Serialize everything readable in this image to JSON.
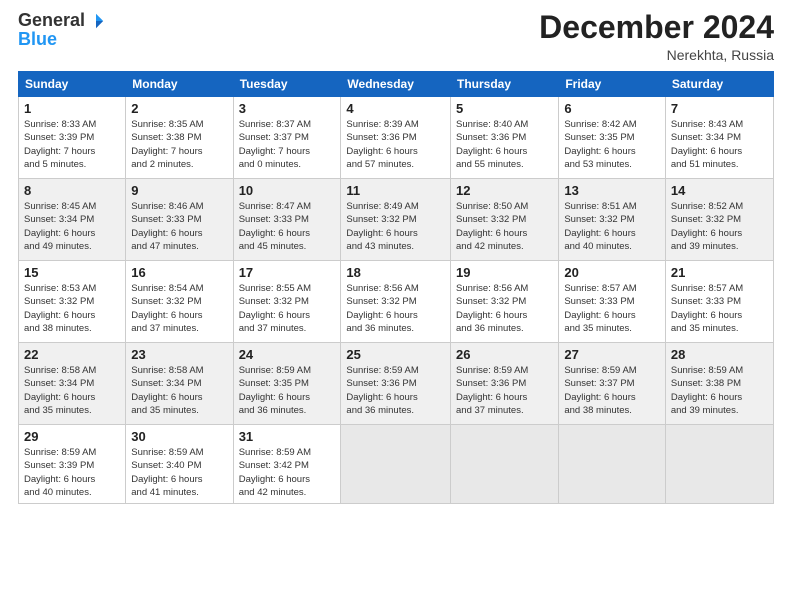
{
  "logo": {
    "general": "General",
    "blue": "Blue"
  },
  "title": "December 2024",
  "location": "Nerekhta, Russia",
  "weekdays": [
    "Sunday",
    "Monday",
    "Tuesday",
    "Wednesday",
    "Thursday",
    "Friday",
    "Saturday"
  ],
  "weeks": [
    [
      {
        "day": "1",
        "sunrise": "8:33 AM",
        "sunset": "3:39 PM",
        "daylight": "7 hours and 5 minutes."
      },
      {
        "day": "2",
        "sunrise": "8:35 AM",
        "sunset": "3:38 PM",
        "daylight": "7 hours and 2 minutes."
      },
      {
        "day": "3",
        "sunrise": "8:37 AM",
        "sunset": "3:37 PM",
        "daylight": "7 hours and 0 minutes."
      },
      {
        "day": "4",
        "sunrise": "8:39 AM",
        "sunset": "3:36 PM",
        "daylight": "6 hours and 57 minutes."
      },
      {
        "day": "5",
        "sunrise": "8:40 AM",
        "sunset": "3:36 PM",
        "daylight": "6 hours and 55 minutes."
      },
      {
        "day": "6",
        "sunrise": "8:42 AM",
        "sunset": "3:35 PM",
        "daylight": "6 hours and 53 minutes."
      },
      {
        "day": "7",
        "sunrise": "8:43 AM",
        "sunset": "3:34 PM",
        "daylight": "6 hours and 51 minutes."
      }
    ],
    [
      {
        "day": "8",
        "sunrise": "8:45 AM",
        "sunset": "3:34 PM",
        "daylight": "6 hours and 49 minutes."
      },
      {
        "day": "9",
        "sunrise": "8:46 AM",
        "sunset": "3:33 PM",
        "daylight": "6 hours and 47 minutes."
      },
      {
        "day": "10",
        "sunrise": "8:47 AM",
        "sunset": "3:33 PM",
        "daylight": "6 hours and 45 minutes."
      },
      {
        "day": "11",
        "sunrise": "8:49 AM",
        "sunset": "3:32 PM",
        "daylight": "6 hours and 43 minutes."
      },
      {
        "day": "12",
        "sunrise": "8:50 AM",
        "sunset": "3:32 PM",
        "daylight": "6 hours and 42 minutes."
      },
      {
        "day": "13",
        "sunrise": "8:51 AM",
        "sunset": "3:32 PM",
        "daylight": "6 hours and 40 minutes."
      },
      {
        "day": "14",
        "sunrise": "8:52 AM",
        "sunset": "3:32 PM",
        "daylight": "6 hours and 39 minutes."
      }
    ],
    [
      {
        "day": "15",
        "sunrise": "8:53 AM",
        "sunset": "3:32 PM",
        "daylight": "6 hours and 38 minutes."
      },
      {
        "day": "16",
        "sunrise": "8:54 AM",
        "sunset": "3:32 PM",
        "daylight": "6 hours and 37 minutes."
      },
      {
        "day": "17",
        "sunrise": "8:55 AM",
        "sunset": "3:32 PM",
        "daylight": "6 hours and 37 minutes."
      },
      {
        "day": "18",
        "sunrise": "8:56 AM",
        "sunset": "3:32 PM",
        "daylight": "6 hours and 36 minutes."
      },
      {
        "day": "19",
        "sunrise": "8:56 AM",
        "sunset": "3:32 PM",
        "daylight": "6 hours and 36 minutes."
      },
      {
        "day": "20",
        "sunrise": "8:57 AM",
        "sunset": "3:33 PM",
        "daylight": "6 hours and 35 minutes."
      },
      {
        "day": "21",
        "sunrise": "8:57 AM",
        "sunset": "3:33 PM",
        "daylight": "6 hours and 35 minutes."
      }
    ],
    [
      {
        "day": "22",
        "sunrise": "8:58 AM",
        "sunset": "3:34 PM",
        "daylight": "6 hours and 35 minutes."
      },
      {
        "day": "23",
        "sunrise": "8:58 AM",
        "sunset": "3:34 PM",
        "daylight": "6 hours and 35 minutes."
      },
      {
        "day": "24",
        "sunrise": "8:59 AM",
        "sunset": "3:35 PM",
        "daylight": "6 hours and 36 minutes."
      },
      {
        "day": "25",
        "sunrise": "8:59 AM",
        "sunset": "3:36 PM",
        "daylight": "6 hours and 36 minutes."
      },
      {
        "day": "26",
        "sunrise": "8:59 AM",
        "sunset": "3:36 PM",
        "daylight": "6 hours and 37 minutes."
      },
      {
        "day": "27",
        "sunrise": "8:59 AM",
        "sunset": "3:37 PM",
        "daylight": "6 hours and 38 minutes."
      },
      {
        "day": "28",
        "sunrise": "8:59 AM",
        "sunset": "3:38 PM",
        "daylight": "6 hours and 39 minutes."
      }
    ],
    [
      {
        "day": "29",
        "sunrise": "8:59 AM",
        "sunset": "3:39 PM",
        "daylight": "6 hours and 40 minutes."
      },
      {
        "day": "30",
        "sunrise": "8:59 AM",
        "sunset": "3:40 PM",
        "daylight": "6 hours and 41 minutes."
      },
      {
        "day": "31",
        "sunrise": "8:59 AM",
        "sunset": "3:42 PM",
        "daylight": "6 hours and 42 minutes."
      },
      null,
      null,
      null,
      null
    ]
  ]
}
